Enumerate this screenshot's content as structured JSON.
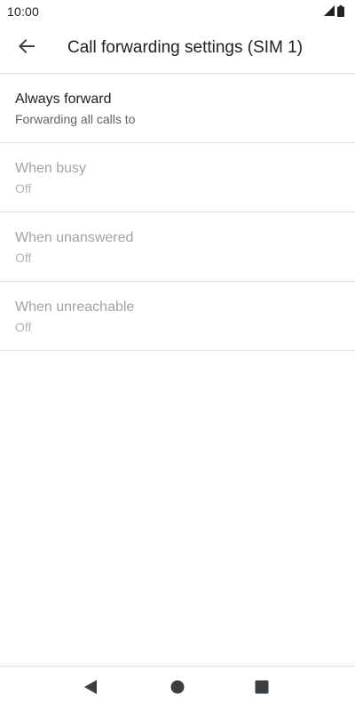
{
  "status_bar": {
    "time": "10:00",
    "icons": [
      "signal-icon",
      "battery-icon"
    ]
  },
  "app_bar": {
    "title": "Call forwarding settings (SIM 1)",
    "back_icon": "arrow-back-icon"
  },
  "settings": [
    {
      "title": "Always forward",
      "summary": "Forwarding all calls to",
      "enabled": true
    },
    {
      "title": "When busy",
      "summary": "Off",
      "enabled": false
    },
    {
      "title": "When unanswered",
      "summary": "Off",
      "enabled": false
    },
    {
      "title": "When unreachable",
      "summary": "Off",
      "enabled": false
    }
  ],
  "nav_bar": {
    "icons": [
      "nav-back-icon",
      "nav-home-icon",
      "nav-recents-icon"
    ]
  },
  "colors": {
    "text_primary": "#202124",
    "text_secondary": "#5f6368",
    "text_disabled": "#a3a3a3",
    "divider": "#e0e0e0",
    "nav_icon": "#3c4043"
  }
}
